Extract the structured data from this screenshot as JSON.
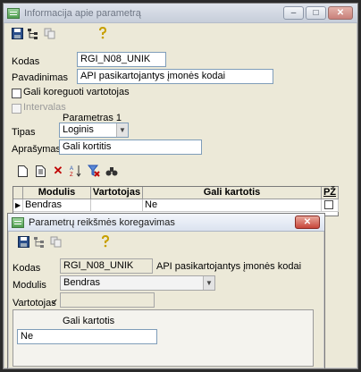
{
  "back_window": {
    "title": "Informacija apie parametrą",
    "title_buttons": {
      "minimize": "–",
      "maximize": "□",
      "close": "✕"
    },
    "toolbar_icons": [
      "save-icon",
      "tree-icon",
      "copy-icon",
      "help-icon"
    ],
    "kodas_label": "Kodas",
    "kodas_value": "RGI_N08_UNIK",
    "pavadinimas_label": "Pavadinimas",
    "pavadinimas_value": "API pasikartojantys įmonės kodai",
    "gali_koreguoti_label": "Gali koreguoti vartotojas",
    "intervalas_label": "Intervalas",
    "parametras_label": "Parametras 1",
    "tipas_label": "Tipas",
    "tipas_value": "Loginis",
    "aprasymas_label": "Aprašymas",
    "aprasymas_value": "Gali kortitis",
    "grid_toolbar_icons": [
      "new-icon",
      "edit-icon",
      "delete-icon",
      "sort-icon",
      "filter-remove-icon",
      "find-icon"
    ],
    "grid": {
      "headers": [
        "Modulis",
        "Vartotojas",
        "Gali kartotis",
        "PŽ"
      ],
      "rows": [
        {
          "modulis": "Bendras",
          "vartotojas": "",
          "gali_kartotis": "Ne",
          "pz": ""
        }
      ]
    }
  },
  "front_window": {
    "title": "Parametrų reikšmės koregavimas",
    "title_buttons": {
      "close": "✕"
    },
    "toolbar_icons": [
      "save-icon",
      "tree-icon",
      "copy-icon",
      "help-icon"
    ],
    "kodas_label": "Kodas",
    "kodas_value": "RGI_N08_UNIK",
    "kodas_desc": "API pasikartojantys įmonės kodai",
    "modulis_label": "Modulis",
    "modulis_value": "Bendras",
    "vartotojas_label": "Vartotojas",
    "vartotojas_value": "",
    "gali_kartotis_label": "Gali kartotis",
    "gali_kartotis_value": "Ne"
  }
}
